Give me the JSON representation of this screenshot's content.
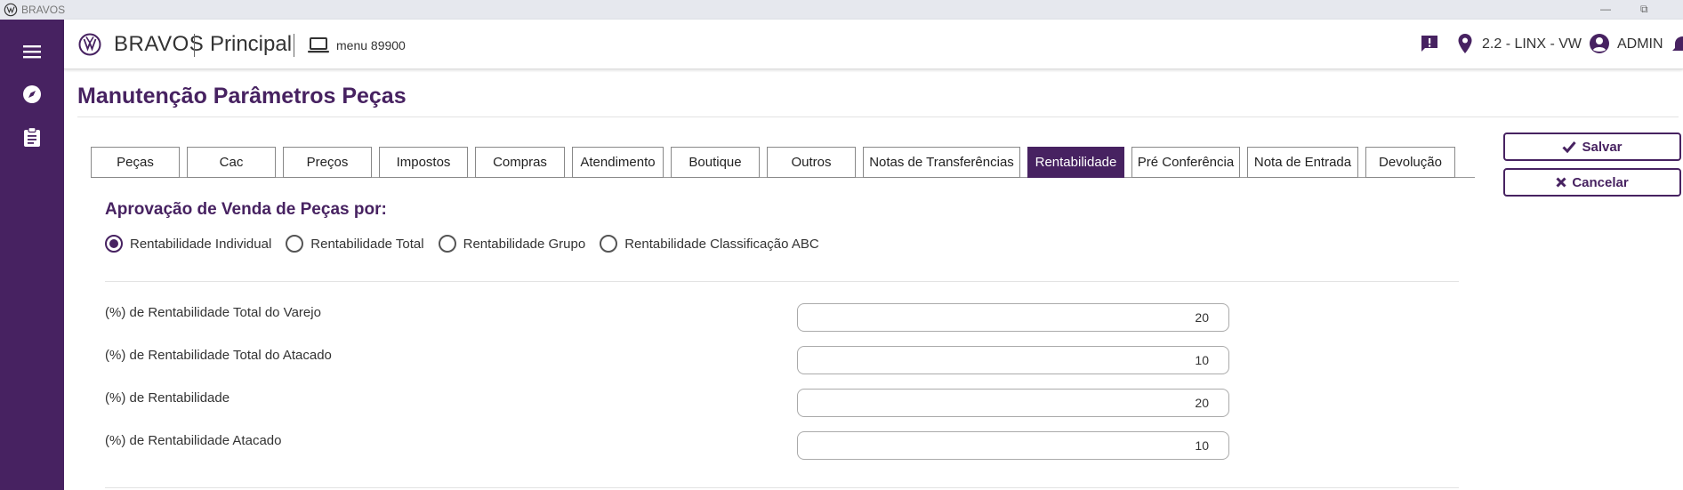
{
  "window": {
    "title": "BRAVOS",
    "minimize": "—",
    "restore": "⧉"
  },
  "header": {
    "brand": "BRAVOS",
    "module": "Principal",
    "menu_code": "menu 89900",
    "location": "2.2 - LINX - VW",
    "user": "ADMIN"
  },
  "page": {
    "title": "Manutenção Parâmetros Peças"
  },
  "tabs": [
    {
      "label": "Peças",
      "active": false
    },
    {
      "label": "Cac",
      "active": false
    },
    {
      "label": "Preços",
      "active": false
    },
    {
      "label": "Impostos",
      "active": false
    },
    {
      "label": "Compras",
      "active": false
    },
    {
      "label": "Atendimento",
      "active": false
    },
    {
      "label": "Boutique",
      "active": false
    },
    {
      "label": "Outros",
      "active": false
    },
    {
      "label": "Notas de Transferências",
      "active": false
    },
    {
      "label": "Rentabilidade",
      "active": true
    },
    {
      "label": "Pré Conferência",
      "active": false
    },
    {
      "label": "Nota de Entrada",
      "active": false
    },
    {
      "label": "Devolução",
      "active": false
    }
  ],
  "actions": {
    "save": "Salvar",
    "cancel": "Cancelar"
  },
  "section": {
    "title": "Aprovação de Venda de Peças por:",
    "options": [
      {
        "label": "Rentabilidade Individual",
        "checked": true
      },
      {
        "label": "Rentabilidade Total",
        "checked": false
      },
      {
        "label": "Rentabilidade Grupo",
        "checked": false
      },
      {
        "label": "Rentabilidade Classificação ABC",
        "checked": false
      }
    ]
  },
  "fields": [
    {
      "label": "(%) de Rentabilidade Total do Varejo",
      "value": "20"
    },
    {
      "label": "(%) de Rentabilidade Total do Atacado",
      "value": "10"
    },
    {
      "label": "(%) de Rentabilidade",
      "value": "20"
    },
    {
      "label": "(%) de Rentabilidade Atacado",
      "value": "10"
    }
  ],
  "colors": {
    "primary": "#472261",
    "rail": "#472261",
    "os_bar": "#e6e8ee"
  },
  "icons": {
    "rail": [
      "menu-icon",
      "compass-icon",
      "clipboard-icon"
    ],
    "header": [
      "vw-logo-icon",
      "laptop-icon",
      "feedback-icon",
      "location-pin-icon",
      "account-circle-icon",
      "bell-icon"
    ]
  }
}
